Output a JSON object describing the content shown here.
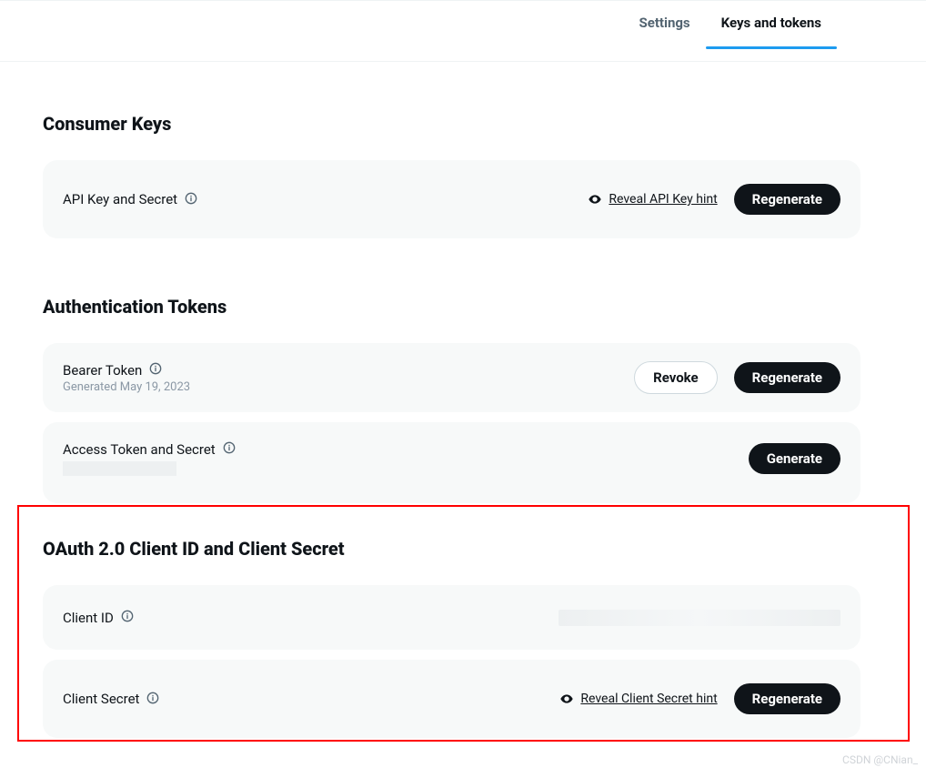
{
  "tabs": {
    "settings": "Settings",
    "keys": "Keys and tokens"
  },
  "consumer": {
    "title": "Consumer Keys",
    "api_key_row": {
      "label": "API Key and Secret",
      "reveal": "Reveal API Key hint",
      "regenerate": "Regenerate"
    }
  },
  "auth": {
    "title": "Authentication Tokens",
    "bearer": {
      "label": "Bearer Token",
      "generated": "Generated May 19, 2023",
      "revoke": "Revoke",
      "regenerate": "Regenerate"
    },
    "access": {
      "label": "Access Token and Secret",
      "generate": "Generate"
    }
  },
  "oauth": {
    "title": "OAuth 2.0 Client ID and Client Secret",
    "client_id": {
      "label": "Client ID"
    },
    "client_secret": {
      "label": "Client Secret",
      "reveal": "Reveal Client Secret hint",
      "regenerate": "Regenerate"
    }
  },
  "watermark": "CSDN @CNian_"
}
